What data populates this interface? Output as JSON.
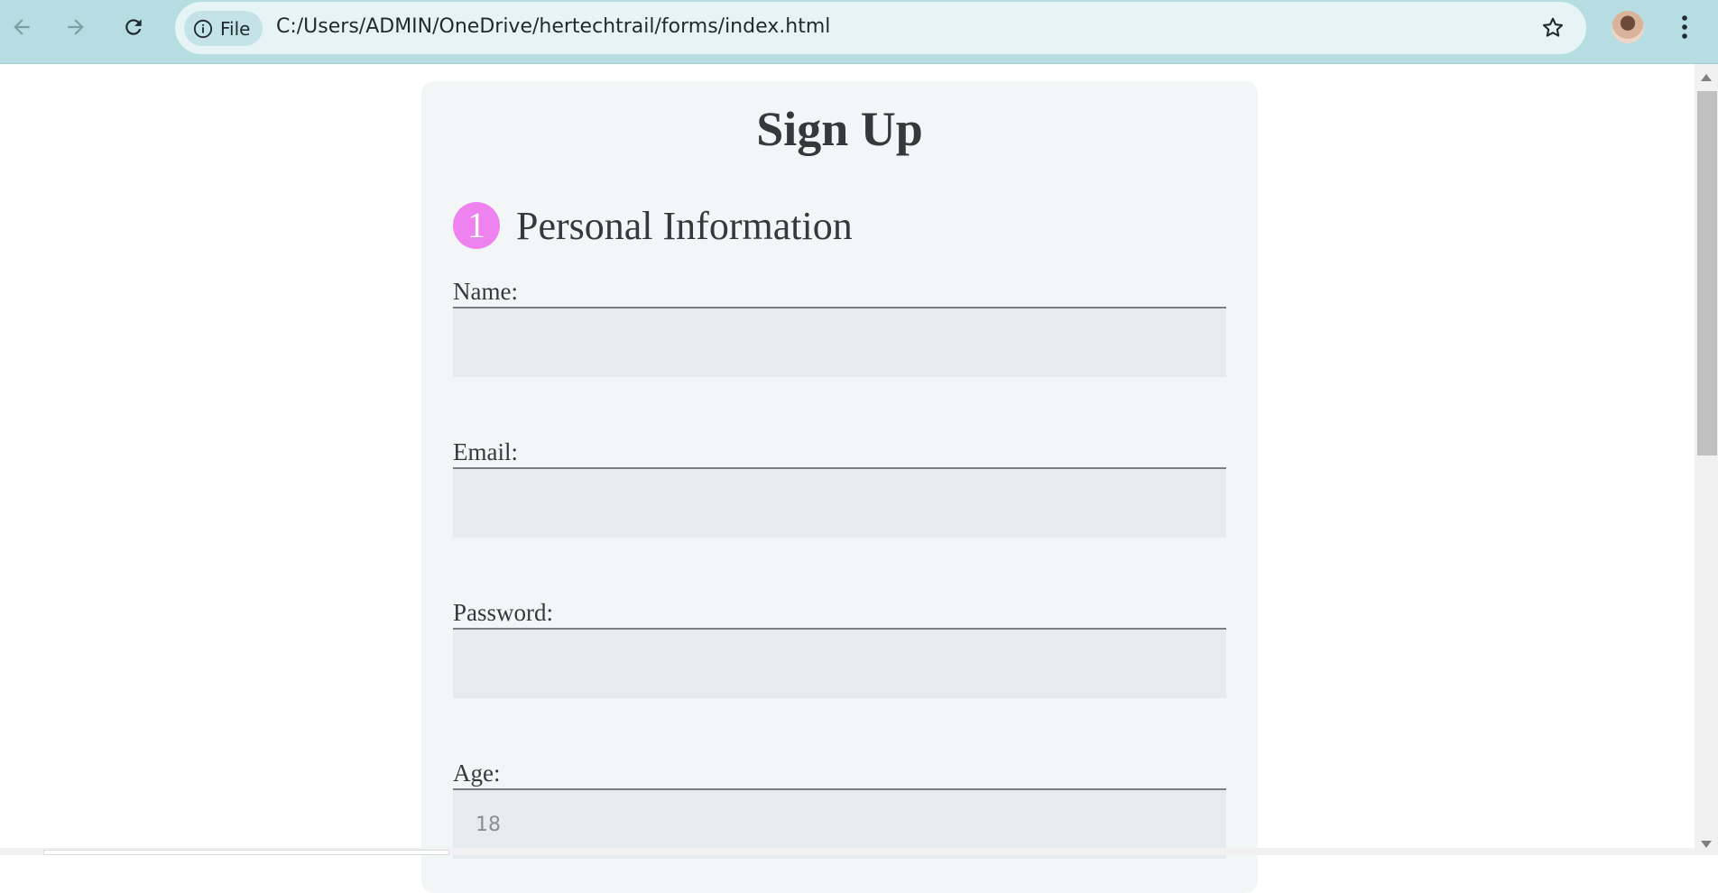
{
  "browser": {
    "chip_label": "File",
    "url": "C:/Users/ADMIN/OneDrive/hertechtrail/forms/index.html",
    "icons": {
      "back": "arrow-left-icon",
      "forward": "arrow-right-icon",
      "reload": "reload-icon",
      "info": "info-icon",
      "bookmark": "star-icon",
      "menu": "kebab-menu-icon"
    },
    "colors": {
      "toolbar": "#b6dde1",
      "omnibox": "#e6f4f5"
    }
  },
  "form": {
    "title": "Sign Up",
    "section": {
      "step": "1",
      "title": "Personal Information",
      "badge_color": "#ee82ee"
    },
    "fields": [
      {
        "label": "Name:",
        "value": "",
        "placeholder": ""
      },
      {
        "label": "Email:",
        "value": "",
        "placeholder": ""
      },
      {
        "label": "Password:",
        "value": "",
        "placeholder": ""
      },
      {
        "label": "Age:",
        "value": "",
        "placeholder": "18"
      }
    ]
  }
}
